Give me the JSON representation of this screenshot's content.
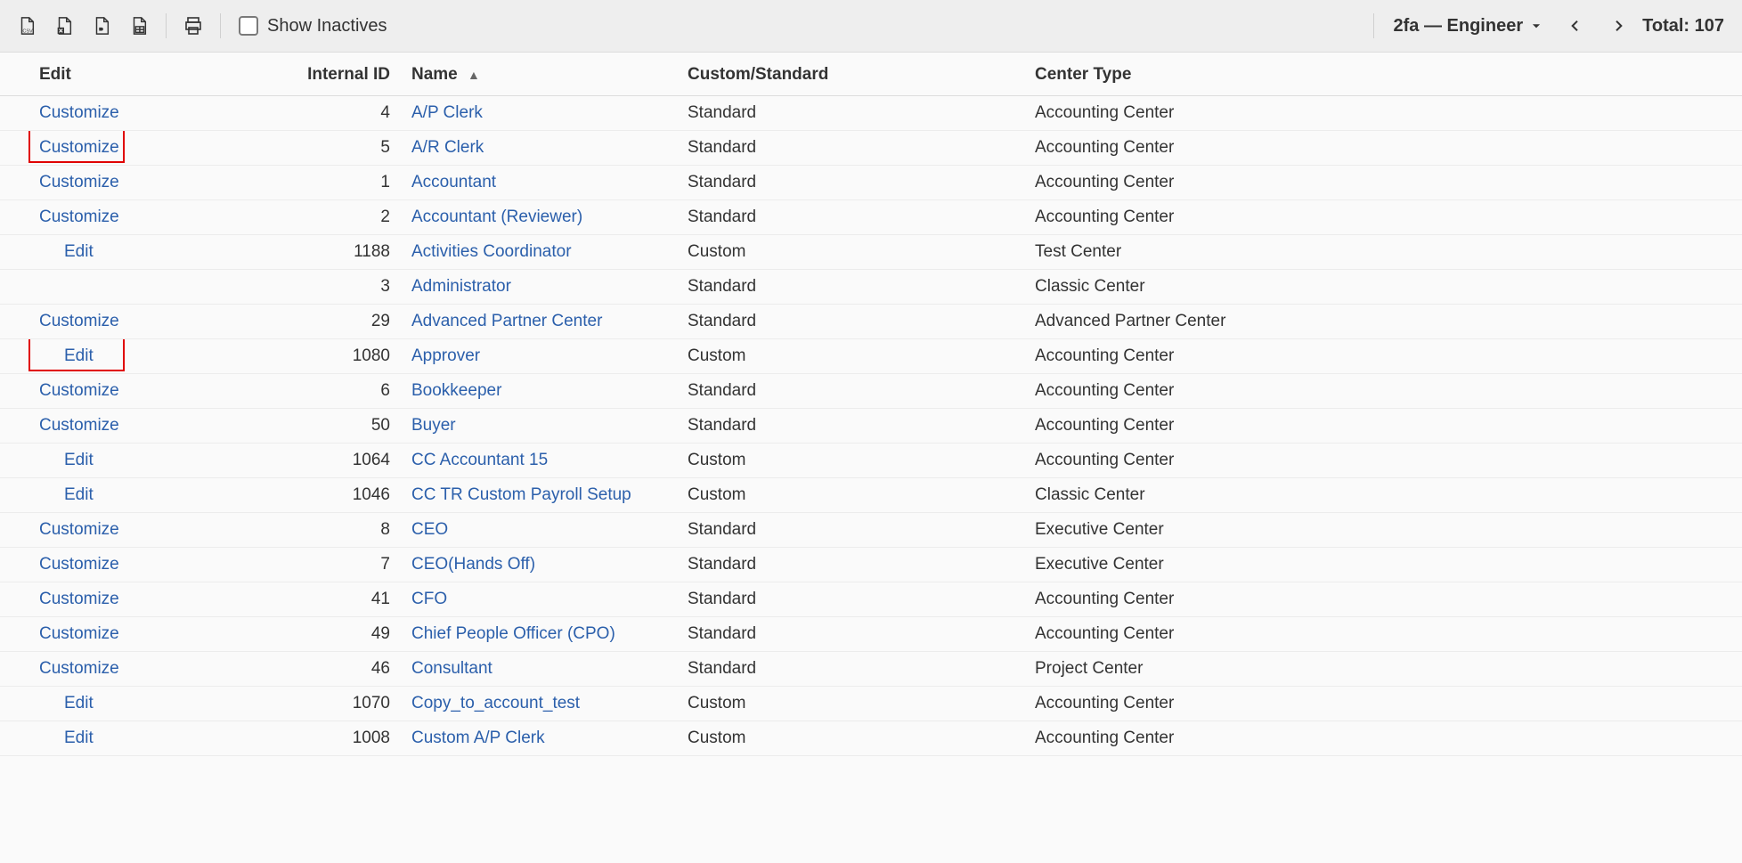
{
  "toolbar": {
    "show_inactives_label": "Show Inactives",
    "view_name": "2fa — Engineer",
    "total_label": "Total: 107"
  },
  "columns": {
    "edit": "Edit",
    "internal_id": "Internal ID",
    "name": "Name",
    "custom_standard": "Custom/Standard",
    "center_type": "Center Type"
  },
  "rows": [
    {
      "edit": "Customize",
      "indent": false,
      "id": "4",
      "name": "A/P Clerk",
      "cs": "Standard",
      "center": "Accounting Center",
      "hl": false
    },
    {
      "edit": "Customize",
      "indent": false,
      "id": "5",
      "name": "A/R Clerk",
      "cs": "Standard",
      "center": "Accounting Center",
      "hl": true
    },
    {
      "edit": "Customize",
      "indent": false,
      "id": "1",
      "name": "Accountant",
      "cs": "Standard",
      "center": "Accounting Center",
      "hl": false
    },
    {
      "edit": "Customize",
      "indent": false,
      "id": "2",
      "name": "Accountant (Reviewer)",
      "cs": "Standard",
      "center": "Accounting Center",
      "hl": false
    },
    {
      "edit": "Edit",
      "indent": true,
      "id": "1188",
      "name": "Activities Coordinator",
      "cs": "Custom",
      "center": "Test Center",
      "hl": false
    },
    {
      "edit": "",
      "indent": false,
      "id": "3",
      "name": "Administrator",
      "cs": "Standard",
      "center": "Classic Center",
      "hl": false
    },
    {
      "edit": "Customize",
      "indent": false,
      "id": "29",
      "name": "Advanced Partner Center",
      "cs": "Standard",
      "center": "Advanced Partner Center",
      "hl": false
    },
    {
      "edit": "Edit",
      "indent": true,
      "id": "1080",
      "name": "Approver",
      "cs": "Custom",
      "center": "Accounting Center",
      "hl": true
    },
    {
      "edit": "Customize",
      "indent": false,
      "id": "6",
      "name": "Bookkeeper",
      "cs": "Standard",
      "center": "Accounting Center",
      "hl": false
    },
    {
      "edit": "Customize",
      "indent": false,
      "id": "50",
      "name": "Buyer",
      "cs": "Standard",
      "center": "Accounting Center",
      "hl": false
    },
    {
      "edit": "Edit",
      "indent": true,
      "id": "1064",
      "name": "CC Accountant 15",
      "cs": "Custom",
      "center": "Accounting Center",
      "hl": false
    },
    {
      "edit": "Edit",
      "indent": true,
      "id": "1046",
      "name": "CC TR Custom Payroll Setup",
      "cs": "Custom",
      "center": "Classic Center",
      "hl": false
    },
    {
      "edit": "Customize",
      "indent": false,
      "id": "8",
      "name": "CEO",
      "cs": "Standard",
      "center": "Executive Center",
      "hl": false
    },
    {
      "edit": "Customize",
      "indent": false,
      "id": "7",
      "name": "CEO(Hands Off)",
      "cs": "Standard",
      "center": "Executive Center",
      "hl": false
    },
    {
      "edit": "Customize",
      "indent": false,
      "id": "41",
      "name": "CFO",
      "cs": "Standard",
      "center": "Accounting Center",
      "hl": false
    },
    {
      "edit": "Customize",
      "indent": false,
      "id": "49",
      "name": "Chief People Officer (CPO)",
      "cs": "Standard",
      "center": "Accounting Center",
      "hl": false
    },
    {
      "edit": "Customize",
      "indent": false,
      "id": "46",
      "name": "Consultant",
      "cs": "Standard",
      "center": "Project Center",
      "hl": false
    },
    {
      "edit": "Edit",
      "indent": true,
      "id": "1070",
      "name": "Copy_to_account_test",
      "cs": "Custom",
      "center": "Accounting Center",
      "hl": false
    },
    {
      "edit": "Edit",
      "indent": true,
      "id": "1008",
      "name": "Custom A/P Clerk",
      "cs": "Custom",
      "center": "Accounting Center",
      "hl": false
    }
  ]
}
